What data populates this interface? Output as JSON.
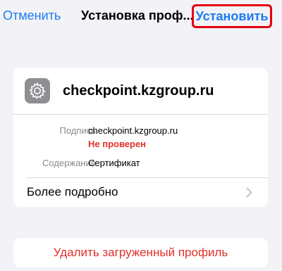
{
  "navbar": {
    "cancel_label": "Отменить",
    "title": "Установка проф...",
    "install_label": "Установить"
  },
  "profile": {
    "icon": "gear-icon",
    "name": "checkpoint.kzgroup.ru",
    "details": {
      "signature_label": "Подпись",
      "signature_value": "checkpoint.kzgroup.ru",
      "signature_status": "Не проверен",
      "contents_label": "Содержание",
      "contents_value": "Сертификат"
    },
    "more_label": "Более подробно",
    "more_icon": "chevron-right-icon"
  },
  "actions": {
    "delete_label": "Удалить загруженный профиль"
  },
  "colors": {
    "accent": "#1b7cf0",
    "destructive": "#e0302a",
    "highlight_border": "#e3000f",
    "background": "#f2f2f7",
    "card": "#ffffff",
    "secondary_text": "#8a8a8e"
  }
}
